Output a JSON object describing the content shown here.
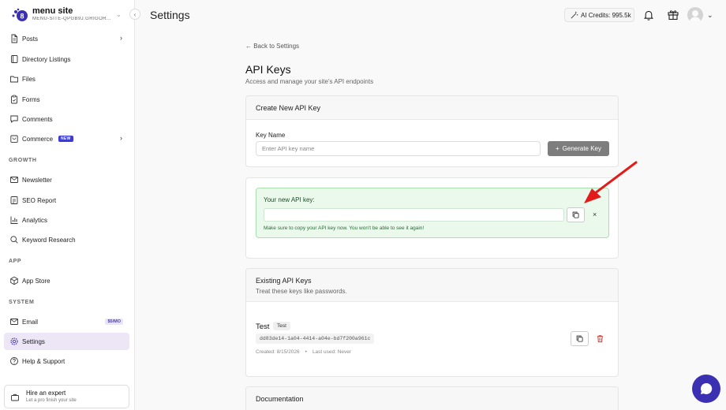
{
  "site": {
    "name": "menu site",
    "slug": "MENU-SITE-QPGB9J.GRIGOR..."
  },
  "sidebar": {
    "items": [
      {
        "label": "Posts",
        "icon": "document-icon"
      },
      {
        "label": "Directory Listings",
        "icon": "book-icon"
      },
      {
        "label": "Files",
        "icon": "folder-icon"
      },
      {
        "label": "Forms",
        "icon": "clipboard-icon"
      },
      {
        "label": "Comments",
        "icon": "comment-icon"
      },
      {
        "label": "Commerce",
        "icon": "cart-icon",
        "badge": "NEW"
      }
    ],
    "growth_label": "GROWTH",
    "growth_items": [
      {
        "label": "Newsletter",
        "icon": "mail-icon"
      },
      {
        "label": "SEO Report",
        "icon": "report-icon"
      },
      {
        "label": "Analytics",
        "icon": "bar-chart-icon"
      },
      {
        "label": "Keyword Research",
        "icon": "search-icon"
      }
    ],
    "app_label": "APP",
    "app_items": [
      {
        "label": "App Store",
        "icon": "package-icon"
      }
    ],
    "system_label": "SYSTEM",
    "system_items": [
      {
        "label": "Email",
        "icon": "mail-icon",
        "badge": "$5/MO"
      },
      {
        "label": "Settings",
        "icon": "gear-icon",
        "active": true
      },
      {
        "label": "Help & Support",
        "icon": "help-icon"
      }
    ],
    "expert": {
      "title": "Hire an expert",
      "subtitle": "Let a pro finish your site"
    }
  },
  "header": {
    "title": "Settings",
    "credits": "AI Credits: 995.5k"
  },
  "main": {
    "back_link": "← Back to Settings",
    "title": "API Keys",
    "subtitle": "Access and manage your site's API endpoints",
    "create": {
      "title": "Create New API Key",
      "key_name_label": "Key Name",
      "key_name_placeholder": "Enter API key name",
      "generate_label": "Generate Key"
    },
    "new_key": {
      "label": "Your new API key:",
      "value": "",
      "warning": "Make sure to copy your API key now. You won't be able to see it again!",
      "close": "×"
    },
    "existing": {
      "title": "Existing API Keys",
      "subtitle": "Treat these keys like passwords.",
      "keys": [
        {
          "name": "Test",
          "tag": "Test",
          "value": "dd83de14-1a04-4414-a04e-bd7f200a961c",
          "created": "Created: 8/15/2026",
          "last_used": "Last used: Never"
        }
      ]
    },
    "documentation": {
      "title": "Documentation"
    }
  },
  "colors": {
    "accent": "#3b2fb2",
    "active_bg": "#ece6f7",
    "success_bg": "#ebf8ec",
    "danger": "#e03131",
    "annotation_arrow": "#e21b1b"
  }
}
